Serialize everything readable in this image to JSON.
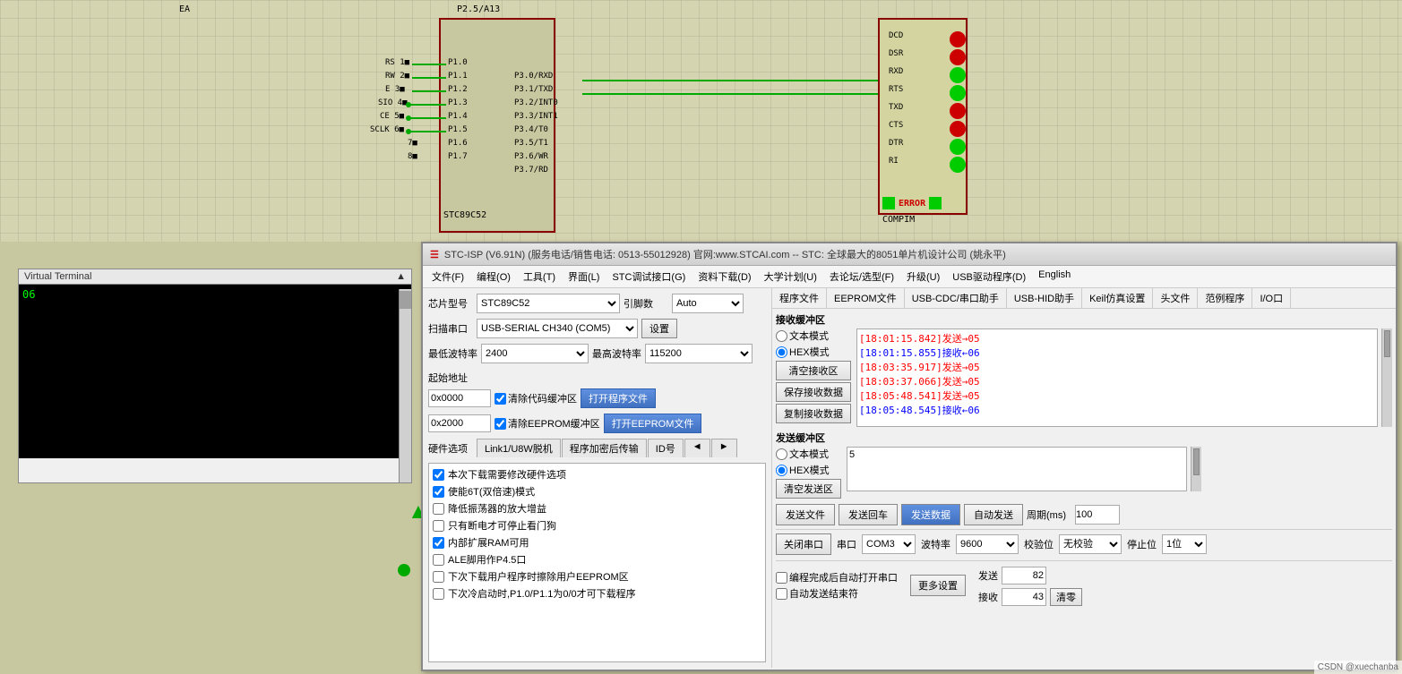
{
  "schematic": {
    "virtual_terminal": {
      "title": "Virtual Terminal",
      "content": "06"
    }
  },
  "stc_window": {
    "title": "STC-ISP (V6.91N) (服务电话/销售电话: 0513-55012928) 官网:www.STCAI.com  -- STC: 全球最大的8051单片机设计公司 (姚永平)",
    "menu": {
      "items": [
        "文件(F)",
        "编程(O)",
        "工具(T)",
        "界面(L)",
        "STC调试接口(G)",
        "资料下载(D)",
        "大学计划(U)",
        "去论坛/选型(F)",
        "升级(U)",
        "USB驱动程序(D)",
        "English"
      ]
    },
    "left_panel": {
      "chip_label": "芯片型号",
      "chip_value": "STC89C52",
      "pins_label": "引脚数",
      "pins_value": "Auto",
      "scan_label": "扫描串口",
      "scan_value": "USB-SERIAL CH340 (COM5)",
      "settings_btn": "设置",
      "min_baud_label": "最低波特率",
      "min_baud_value": "2400",
      "max_baud_label": "最高波特率",
      "max_baud_value": "115200",
      "start_addr_label": "起始地址",
      "addr1_value": "0x0000",
      "clear_code_label": "清除代码缓冲区",
      "open_prog_btn": "打开程序文件",
      "addr2_value": "0x2000",
      "clear_eeprom_label": "清除EEPROM缓冲区",
      "open_eeprom_btn": "打开EEPROM文件",
      "hardware_label": "硬件选项",
      "tabs": [
        "Link1/U8W脱机",
        "程序加密后传输",
        "ID号",
        "◄",
        "►"
      ],
      "options": [
        {
          "checked": true,
          "label": "本次下载需要修改硬件选项"
        },
        {
          "checked": true,
          "label": "使能6T(双倍速)模式"
        },
        {
          "checked": false,
          "label": "降低振荡器的放大增益"
        },
        {
          "checked": false,
          "label": "只有断电才可停止看门狗"
        },
        {
          "checked": true,
          "label": "内部扩展RAM可用"
        },
        {
          "checked": false,
          "label": "ALE脚用作P4.5口"
        },
        {
          "checked": false,
          "label": "下次下载用户程序时擦除用户EEPROM区"
        },
        {
          "checked": false,
          "label": "下次冷启动时,P1.0/P1.1为0/0才可下载程序"
        }
      ]
    },
    "right_panel": {
      "tabs": [
        "程序文件",
        "EEPROM文件",
        "USB-CDC/串口助手",
        "USB-HID助手",
        "Keil仿真设置",
        "头文件",
        "范例程序",
        "I/O口"
      ],
      "recv_section": {
        "title": "接收缓冲区",
        "text_mode_label": "文本模式",
        "hex_mode_label": "HEX模式",
        "hex_mode_checked": true,
        "text_mode_checked": false,
        "clear_recv_btn": "清空接收区",
        "save_recv_btn": "保存接收数据",
        "copy_recv_btn": "复制接收数据",
        "log": [
          {
            "type": "send",
            "text": "[18:01:15.842]发送→05"
          },
          {
            "type": "recv",
            "text": "[18:01:15.855]接收←06"
          },
          {
            "type": "send",
            "text": "[18:03:35.917]发送→05"
          },
          {
            "type": "send",
            "text": "[18:03:37.066]发送→05"
          },
          {
            "type": "send",
            "text": "[18:05:48.541]发送→05"
          },
          {
            "type": "recv",
            "text": "[18:05:48.545]接收←06"
          }
        ]
      },
      "send_section": {
        "title": "发送缓冲区",
        "text_mode_label": "文本模式",
        "hex_mode_label": "HEX模式",
        "hex_mode_checked": true,
        "text_mode_checked": false,
        "clear_send_btn": "清空发送区",
        "send_content": "5"
      },
      "action_buttons": {
        "send_file_btn": "发送文件",
        "send_return_btn": "发送回车",
        "send_data_btn": "发送数据",
        "auto_send_btn": "自动发送",
        "period_label": "周期(ms)",
        "period_value": "100"
      },
      "bottom": {
        "port_label": "串口",
        "port_value": "COM3",
        "baud_label": "波特率",
        "baud_value": "9600",
        "check_label": "校验位",
        "check_value": "无校验",
        "stop_label": "停止位",
        "stop_value": "1位",
        "close_btn": "关闭串口",
        "auto_open_label": "编程完成后自动打开串口",
        "auto_open_checked": false,
        "auto_end_label": "自动发送结束符",
        "auto_end_checked": false,
        "more_btn": "更多设置",
        "send_count_label": "发送",
        "send_count": "82",
        "recv_count_label": "接收",
        "recv_count": "43",
        "clear_btn": "清零"
      }
    }
  }
}
